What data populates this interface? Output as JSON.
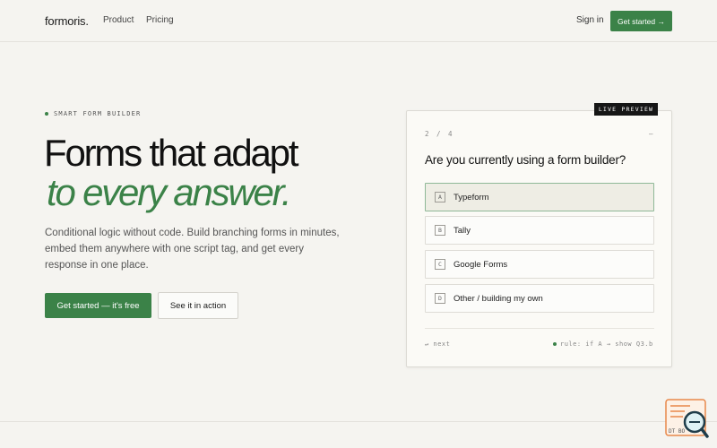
{
  "nav": {
    "logo": "formoris.",
    "links": [
      {
        "label": "Product"
      },
      {
        "label": "Pricing"
      }
    ],
    "signin": "Sign in",
    "cta": "Get started →"
  },
  "hero": {
    "eyebrow": "SMART FORM BUILDER",
    "headline_line1": "Forms that adapt",
    "headline_line2": "to every answer.",
    "subtext": "Conditional logic without code. Build branching forms in minutes, embed them anywhere with one script tag, and get every response in one place.",
    "primary_button": "Get started — it's free",
    "secondary_button": "See it in action"
  },
  "preview": {
    "badge": "LIVE PREVIEW",
    "step": "2 / 4",
    "step_dash": "—",
    "question": "Are you currently using a form builder?",
    "options": [
      {
        "key": "A",
        "label": "Typeform",
        "selected": true
      },
      {
        "key": "B",
        "label": "Tally",
        "selected": false
      },
      {
        "key": "C",
        "label": "Google Forms",
        "selected": false
      },
      {
        "key": "D",
        "label": "Other / building my own",
        "selected": false
      }
    ],
    "next": "↵ next",
    "rule": "rule: if A → show Q3.b"
  },
  "colors": {
    "accent": "#3b8248",
    "background": "#f5f4f0",
    "badge": "#161616"
  },
  "corner_logo": {
    "text": "DT BO"
  }
}
